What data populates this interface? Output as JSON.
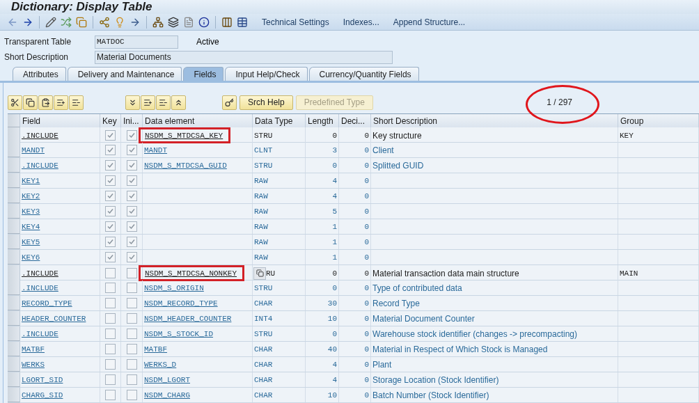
{
  "window": {
    "title": "Dictionary: Display Table"
  },
  "toolbar": {
    "links": [
      "Technical Settings",
      "Indexes...",
      "Append Structure..."
    ]
  },
  "header": {
    "table_label": "Transparent Table",
    "table_value": "MATDOC",
    "status": "Active",
    "description_label": "Short Description",
    "description_value": "Material Documents"
  },
  "tabs": [
    {
      "label": "Attributes",
      "selected": false
    },
    {
      "label": "Delivery and Maintenance",
      "selected": false
    },
    {
      "label": "Fields",
      "selected": true
    },
    {
      "label": "Input Help/Check",
      "selected": false
    },
    {
      "label": "Currency/Quantity Fields",
      "selected": false
    }
  ],
  "table_toolbar": {
    "buttons": [
      {
        "label": "Srch Help",
        "disabled": false
      },
      {
        "label": "Predefined Type",
        "disabled": true
      }
    ],
    "counter": "1 / 297",
    "counter_circled": true
  },
  "table": {
    "columns": [
      "Field",
      "Key",
      "Ini...",
      "Data element",
      "Data Type",
      "Length",
      "Deci...",
      "Short Description",
      "Group"
    ],
    "rows": [
      {
        "field": ".INCLUDE",
        "key": true,
        "initial": true,
        "data_element": "NSDM_S_MTDCSA_KEY",
        "data_type": "STRU",
        "length": "0",
        "decimals": "0",
        "description": "Key structure",
        "group": "KEY",
        "emphasized": true,
        "marked": true,
        "copy_button": false
      },
      {
        "field": "MANDT",
        "key": true,
        "initial": true,
        "data_element": "MANDT",
        "data_type": "CLNT",
        "length": "3",
        "decimals": "0",
        "description": "Client",
        "group": "",
        "emphasized": false,
        "marked": false,
        "copy_button": false
      },
      {
        "field": ".INCLUDE",
        "key": true,
        "initial": true,
        "data_element": "NSDM_S_MTDCSA_GUID",
        "data_type": "STRU",
        "length": "0",
        "decimals": "0",
        "description": "Splitted GUID",
        "group": "",
        "emphasized": false,
        "marked": false,
        "copy_button": false
      },
      {
        "field": "KEY1",
        "key": true,
        "initial": true,
        "data_element": "",
        "data_type": "RAW",
        "length": "4",
        "decimals": "0",
        "description": "",
        "group": "",
        "emphasized": false,
        "marked": false,
        "copy_button": false
      },
      {
        "field": "KEY2",
        "key": true,
        "initial": true,
        "data_element": "",
        "data_type": "RAW",
        "length": "4",
        "decimals": "0",
        "description": "",
        "group": "",
        "emphasized": false,
        "marked": false,
        "copy_button": false
      },
      {
        "field": "KEY3",
        "key": true,
        "initial": true,
        "data_element": "",
        "data_type": "RAW",
        "length": "5",
        "decimals": "0",
        "description": "",
        "group": "",
        "emphasized": false,
        "marked": false,
        "copy_button": false
      },
      {
        "field": "KEY4",
        "key": true,
        "initial": true,
        "data_element": "",
        "data_type": "RAW",
        "length": "1",
        "decimals": "0",
        "description": "",
        "group": "",
        "emphasized": false,
        "marked": false,
        "copy_button": false
      },
      {
        "field": "KEY5",
        "key": true,
        "initial": true,
        "data_element": "",
        "data_type": "RAW",
        "length": "1",
        "decimals": "0",
        "description": "",
        "group": "",
        "emphasized": false,
        "marked": false,
        "copy_button": false
      },
      {
        "field": "KEY6",
        "key": true,
        "initial": true,
        "data_element": "",
        "data_type": "RAW",
        "length": "1",
        "decimals": "0",
        "description": "",
        "group": "",
        "emphasized": false,
        "marked": false,
        "copy_button": false
      },
      {
        "field": ".INCLUDE",
        "key": false,
        "initial": false,
        "data_element": "NSDM_S_MTDCSA_NONKEY",
        "data_type": "RU",
        "length": "0",
        "decimals": "0",
        "description": "Material transaction data main structure",
        "group": "MAIN",
        "emphasized": true,
        "marked": true,
        "copy_button": true
      },
      {
        "field": ".INCLUDE",
        "key": false,
        "initial": false,
        "data_element": "NSDM_S_ORIGIN",
        "data_type": "STRU",
        "length": "0",
        "decimals": "0",
        "description": "Type of contributed data",
        "group": "",
        "emphasized": false,
        "marked": false,
        "copy_button": false
      },
      {
        "field": "RECORD_TYPE",
        "key": false,
        "initial": false,
        "data_element": "NSDM_RECORD_TYPE",
        "data_type": "CHAR",
        "length": "30",
        "decimals": "0",
        "description": "Record Type",
        "group": "",
        "emphasized": false,
        "marked": false,
        "copy_button": false
      },
      {
        "field": "HEADER_COUNTER",
        "key": false,
        "initial": false,
        "data_element": "NSDM_HEADER_COUNTER",
        "data_type": "INT4",
        "length": "10",
        "decimals": "0",
        "description": "Material Document Counter",
        "group": "",
        "emphasized": false,
        "marked": false,
        "copy_button": false
      },
      {
        "field": ".INCLUDE",
        "key": false,
        "initial": false,
        "data_element": "NSDM_S_STOCK_ID",
        "data_type": "STRU",
        "length": "0",
        "decimals": "0",
        "description": "Warehouse stock identifier (changes -> precompacting)",
        "group": "",
        "emphasized": false,
        "marked": false,
        "copy_button": false
      },
      {
        "field": "MATBF",
        "key": false,
        "initial": false,
        "data_element": "MATBF",
        "data_type": "CHAR",
        "length": "40",
        "decimals": "0",
        "description": "Material in Respect of Which Stock is Managed",
        "group": "",
        "emphasized": false,
        "marked": false,
        "copy_button": false
      },
      {
        "field": "WERKS",
        "key": false,
        "initial": false,
        "data_element": "WERKS_D",
        "data_type": "CHAR",
        "length": "4",
        "decimals": "0",
        "description": "Plant",
        "group": "",
        "emphasized": false,
        "marked": false,
        "copy_button": false
      },
      {
        "field": "LGORT_SID",
        "key": false,
        "initial": false,
        "data_element": "NSDM_LGORT",
        "data_type": "CHAR",
        "length": "4",
        "decimals": "0",
        "description": "Storage Location (Stock Identifier)",
        "group": "",
        "emphasized": false,
        "marked": false,
        "copy_button": false
      },
      {
        "field": "CHARG_SID",
        "key": false,
        "initial": false,
        "data_element": "NSDM_CHARG",
        "data_type": "CHAR",
        "length": "10",
        "decimals": "0",
        "description": "Batch Number (Stock Identifier)",
        "group": "",
        "emphasized": false,
        "marked": false,
        "copy_button": false
      }
    ]
  }
}
